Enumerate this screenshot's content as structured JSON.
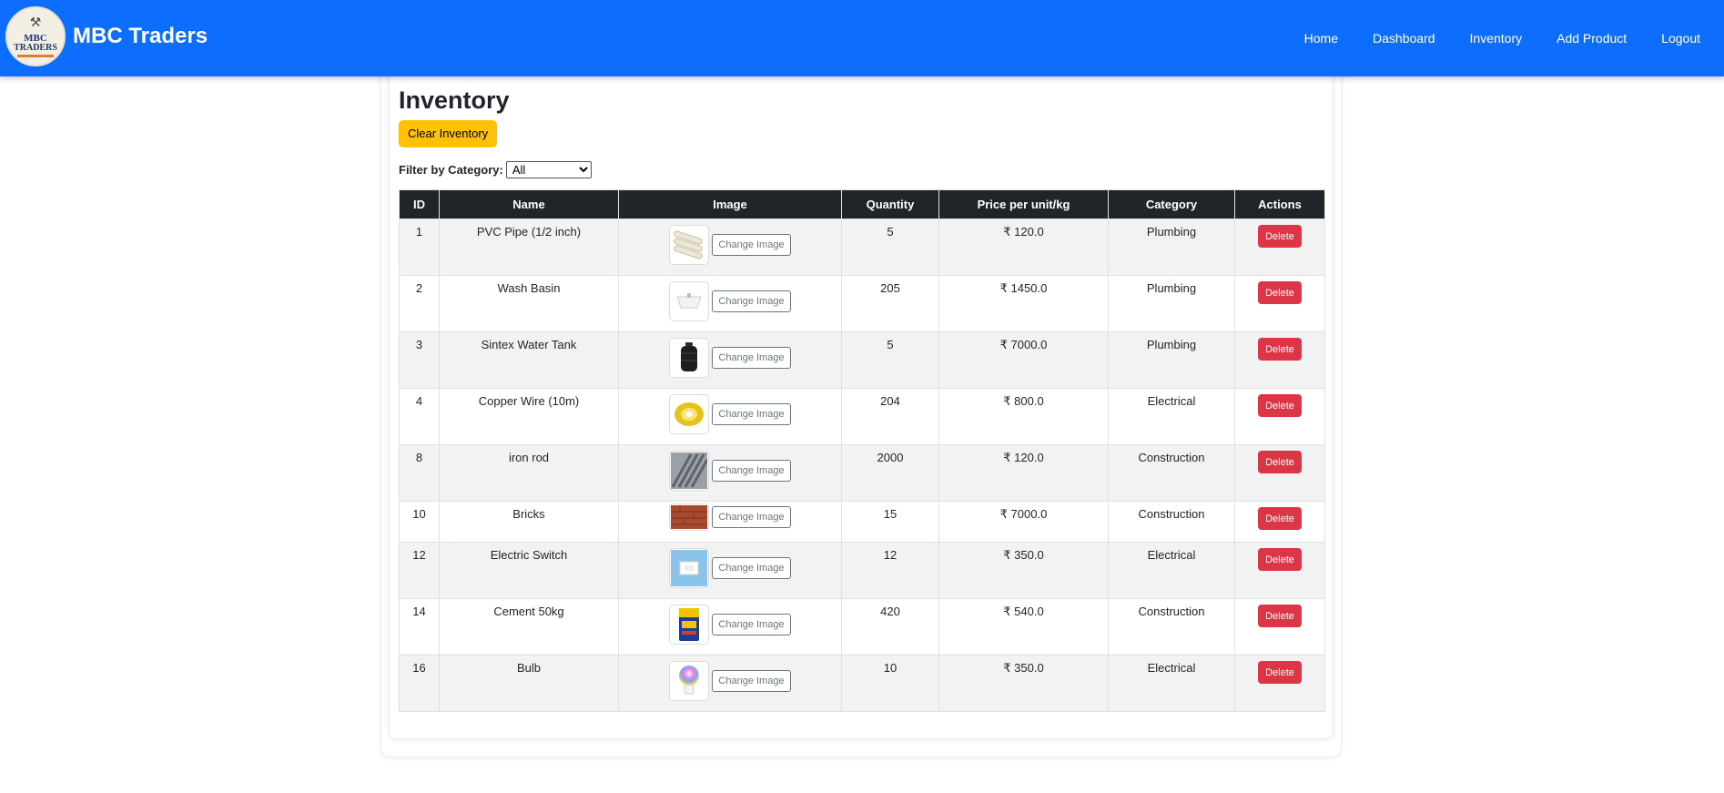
{
  "navbar": {
    "brand": "MBC Traders",
    "logo_text_top": "MBC",
    "logo_text_bottom": "TRADERS",
    "links": [
      "Home",
      "Dashboard",
      "Inventory",
      "Add Product",
      "Logout"
    ]
  },
  "page": {
    "title": "Inventory",
    "clear_button": "Clear Inventory",
    "filter_label": "Filter by Category:",
    "filter_selected": "All"
  },
  "table": {
    "headers": [
      "ID",
      "Name",
      "Image",
      "Quantity",
      "Price per unit/kg",
      "Category",
      "Actions"
    ],
    "change_image_label": "Change Image",
    "delete_label": "Delete",
    "rows": [
      {
        "id": "1",
        "name": "PVC Pipe (1/2 inch)",
        "quantity": "5",
        "price": "₹ 120.0",
        "category": "Plumbing",
        "image_icon": "pvc-pipe-icon"
      },
      {
        "id": "2",
        "name": "Wash Basin",
        "quantity": "205",
        "price": "₹ 1450.0",
        "category": "Plumbing",
        "image_icon": "wash-basin-icon"
      },
      {
        "id": "3",
        "name": "Sintex Water Tank",
        "quantity": "5",
        "price": "₹ 7000.0",
        "category": "Plumbing",
        "image_icon": "water-tank-icon"
      },
      {
        "id": "4",
        "name": "Copper Wire (10m)",
        "quantity": "204",
        "price": "₹ 800.0",
        "category": "Electrical",
        "image_icon": "wire-coil-icon"
      },
      {
        "id": "8",
        "name": "iron rod",
        "quantity": "2000",
        "price": "₹ 120.0",
        "category": "Construction",
        "image_icon": "iron-rods-icon"
      },
      {
        "id": "10",
        "name": "Bricks",
        "quantity": "15",
        "price": "₹ 7000.0",
        "category": "Construction",
        "image_icon": "bricks-icon"
      },
      {
        "id": "12",
        "name": "Electric Switch",
        "quantity": "12",
        "price": "₹ 350.0",
        "category": "Electrical",
        "image_icon": "switch-icon"
      },
      {
        "id": "14",
        "name": "Cement 50kg",
        "quantity": "420",
        "price": "₹ 540.0",
        "category": "Construction",
        "image_icon": "cement-bag-icon"
      },
      {
        "id": "16",
        "name": "Bulb",
        "quantity": "10",
        "price": "₹ 350.0",
        "category": "Electrical",
        "image_icon": "bulb-icon"
      }
    ]
  },
  "colors": {
    "navbar": "#0d6efd",
    "clear_button": "#ffc107",
    "delete_button": "#dc3545",
    "table_header": "#212529"
  }
}
